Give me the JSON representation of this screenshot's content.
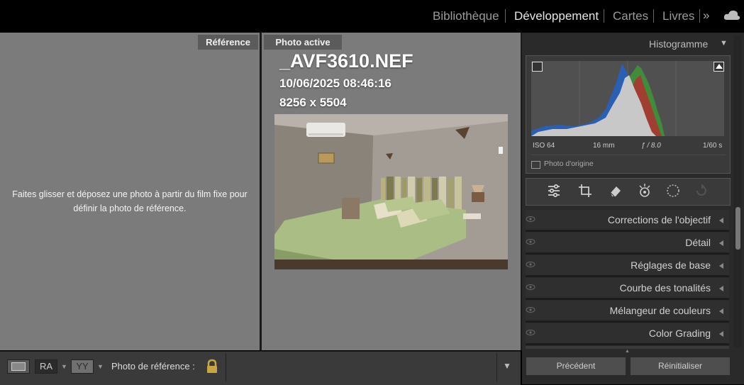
{
  "modules": [
    "Bibliothèque",
    "Développement",
    "Cartes",
    "Livres"
  ],
  "reference_pane": {
    "tab": "Référence",
    "drop_hint_line1": "Faites glisser et déposez une photo à partir du film fixe pour",
    "drop_hint_line2": "définir la photo de référence."
  },
  "active_pane": {
    "tab": "Photo active",
    "filename": "_AVF3610.NEF",
    "datetime": "10/06/2025 08:46:16",
    "dimensions": "8256 x 5504"
  },
  "histogram": {
    "title": "Histogramme",
    "iso": "ISO 64",
    "focal": "16 mm",
    "aperture": "ƒ / 8.0",
    "shutter": "1/60 s",
    "original_label": "Photo d'origine"
  },
  "panels": [
    "Corrections de l'objectif",
    "Détail",
    "Réglages de base",
    "Courbe des tonalités",
    "Mélangeur de couleurs",
    "Color Grading"
  ],
  "bottom_toolbar": {
    "view_ra": "RA",
    "view_yy": "YY",
    "ref_label": "Photo de référence :"
  },
  "buttons": {
    "previous": "Précédent",
    "reset": "Réinitialiser"
  },
  "colors": {
    "canvas_gray": "#7b7b7b",
    "panel_dark": "#2a2a2a",
    "hist_blue": "#2b5fb3",
    "hist_green": "#3f8d3a",
    "hist_red": "#b03030"
  },
  "icons": [
    "more-modules-icon",
    "cloud-icon",
    "disclosure-triangle-icon",
    "edit-sliders-icon",
    "crop-icon",
    "eraser-icon",
    "redeye-icon",
    "mask-icon",
    "history-icon",
    "eye-icon",
    "lock-icon",
    "dropdown-icon"
  ]
}
